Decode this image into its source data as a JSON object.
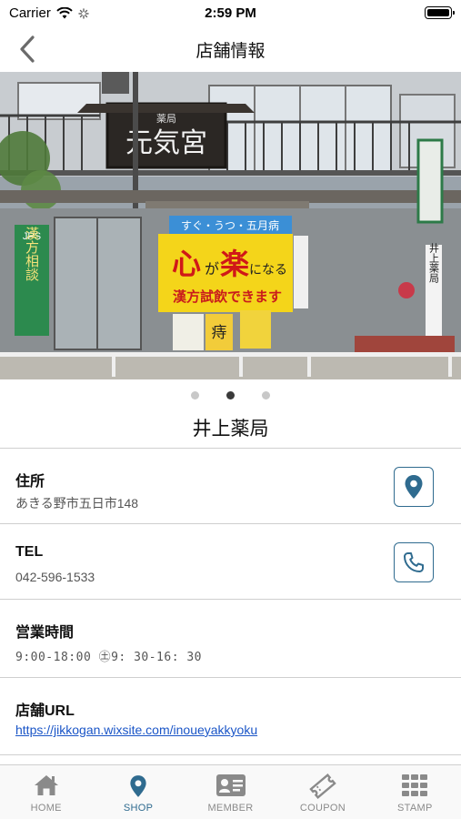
{
  "status_bar": {
    "carrier": "Carrier",
    "time": "2:59 PM"
  },
  "nav": {
    "title": "店舗情報",
    "back_icon": "chevron-left-icon"
  },
  "carousel": {
    "page_count": 3,
    "active_page": 2,
    "photo": {
      "signboard": "元気宮",
      "signboard_small": "薬局",
      "left_banner_top": "JPS",
      "left_banner": "漢方相談",
      "store_sign_top": "すぐ・うつ・五月病",
      "store_sign_main_1": "心",
      "store_sign_main_2": "が",
      "store_sign_main_3": "楽",
      "store_sign_main_4": "になる",
      "store_sign_bottom": "漢方試飲できます",
      "poster_1": "痔",
      "right_sign": "井上薬局"
    }
  },
  "shop": {
    "name": "井上薬局"
  },
  "address": {
    "label": "住所",
    "value": "あきる野市五日市148",
    "icon": "map-pin-icon"
  },
  "tel": {
    "label": "TEL",
    "value": "042-596-1533",
    "icon": "phone-icon"
  },
  "hours": {
    "label": "営業時間",
    "value": "9:00-18:00  ㊏9: 30-16: 30"
  },
  "url": {
    "label": "店舗URL",
    "value": "https://jikkogan.wixsite.com/inoueyakkyoku"
  },
  "tabs": [
    {
      "label": "HOME",
      "icon": "home-icon",
      "active": false
    },
    {
      "label": "SHOP",
      "icon": "map-pin-icon",
      "active": true
    },
    {
      "label": "MEMBER",
      "icon": "member-card-icon",
      "active": false
    },
    {
      "label": "COUPON",
      "icon": "coupon-ticket-icon",
      "active": false
    },
    {
      "label": "STAMP",
      "icon": "stamp-grid-icon",
      "active": false
    }
  ],
  "colors": {
    "accent": "#2f6b8f",
    "link": "#1a55c7",
    "tab_inactive": "#8a8a8a"
  }
}
